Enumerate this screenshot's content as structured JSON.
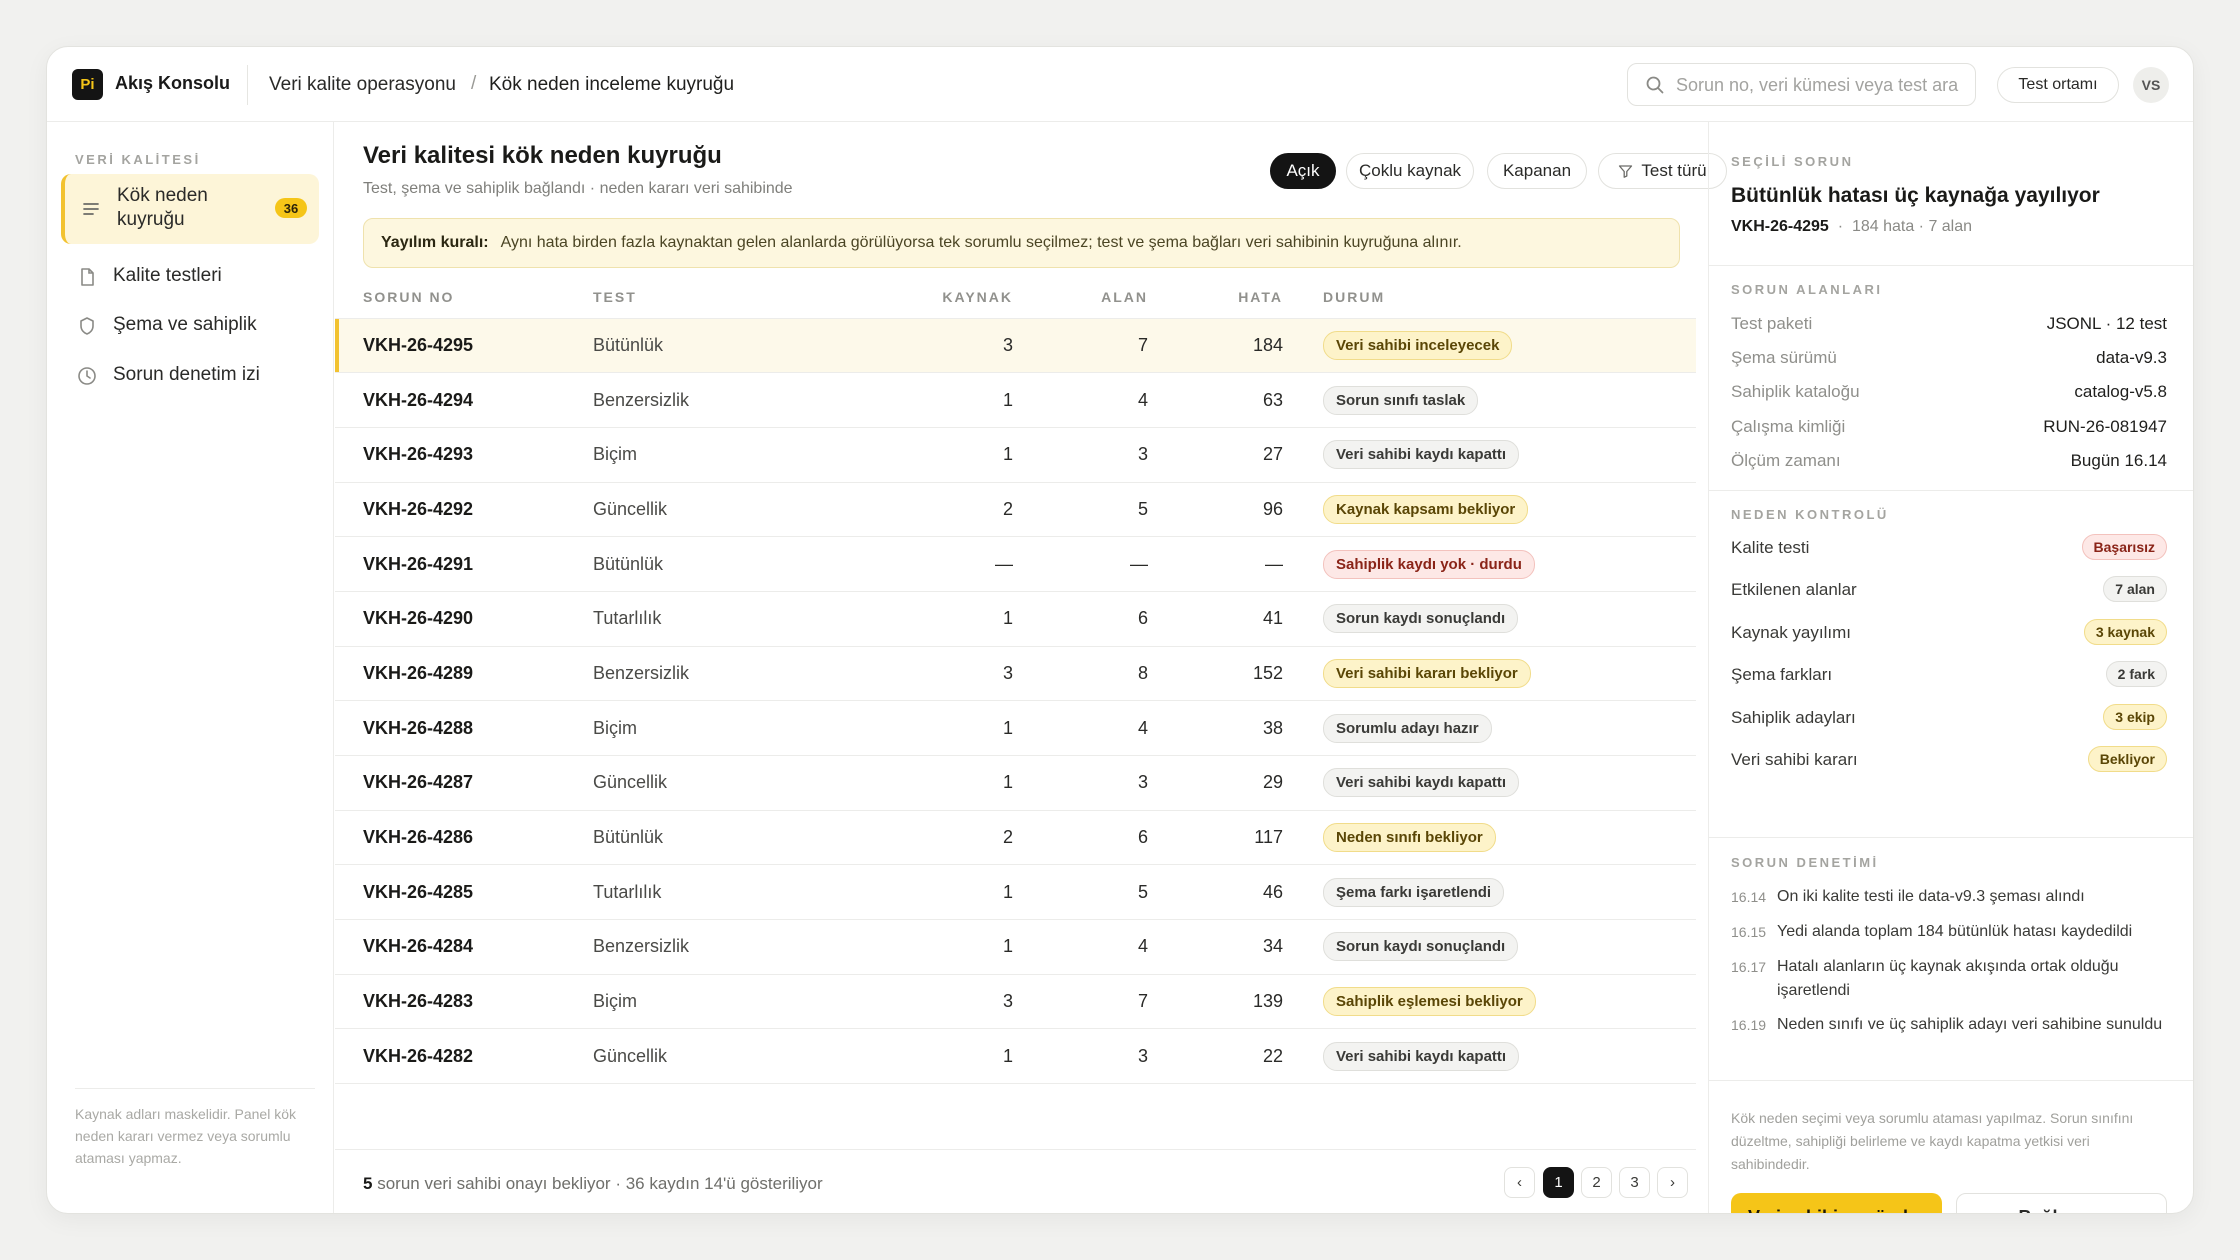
{
  "topbar": {
    "logo": "Pi",
    "app_title": "Akış Konsolu",
    "breadcrumb": [
      "Veri kalite operasyonu",
      "Kök neden inceleme kuyruğu"
    ],
    "breadcrumb_sep": "/",
    "search_placeholder": "Sorun no, veri kümesi veya test ara",
    "env_label": "Test ortamı",
    "avatar": "VS"
  },
  "sidebar": {
    "heading": "VERİ KALİTESİ",
    "items": [
      {
        "label": "Kök neden kuyruğu",
        "badge": "36",
        "icon": "list-icon"
      },
      {
        "label": "Kalite testleri",
        "icon": "document-icon"
      },
      {
        "label": "Şema ve sahiplik",
        "icon": "shield-icon"
      },
      {
        "label": "Sorun denetim izi",
        "icon": "clock-icon"
      }
    ],
    "footnote": "Kaynak adları maskelidir. Panel kök neden kararı vermez veya sorumlu ataması yapmaz."
  },
  "main": {
    "title": "Veri kalitesi kök neden kuyruğu",
    "subtitle": "Test, şema ve sahiplik bağlandı · neden kararı veri sahibinde",
    "filters": [
      "Açık",
      "Çoklu kaynak",
      "Kapanan",
      "Test türü"
    ],
    "rule_label": "Yayılım kuralı:",
    "rule_text": "Aynı hata birden fazla kaynaktan gelen alanlarda görülüyorsa tek sorumlu seçilmez; test ve şema bağları veri sahibinin kuyruğuna alınır.",
    "columns": [
      "SORUN NO",
      "TEST",
      "KAYNAK",
      "ALAN",
      "HATA",
      "DURUM"
    ],
    "rows": [
      {
        "id": "VKH-26-4295",
        "test": "Bütünlük",
        "kaynak": "3",
        "alan": "7",
        "hata": "184",
        "status": "Veri sahibi inceleyecek",
        "tone": "yellow"
      },
      {
        "id": "VKH-26-4294",
        "test": "Benzersizlik",
        "kaynak": "1",
        "alan": "4",
        "hata": "63",
        "status": "Sorun sınıfı taslak",
        "tone": "gray"
      },
      {
        "id": "VKH-26-4293",
        "test": "Biçim",
        "kaynak": "1",
        "alan": "3",
        "hata": "27",
        "status": "Veri sahibi kaydı kapattı",
        "tone": "gray"
      },
      {
        "id": "VKH-26-4292",
        "test": "Güncellik",
        "kaynak": "2",
        "alan": "5",
        "hata": "96",
        "status": "Kaynak kapsamı bekliyor",
        "tone": "yellow"
      },
      {
        "id": "VKH-26-4291",
        "test": "Bütünlük",
        "kaynak": "—",
        "alan": "—",
        "hata": "—",
        "status": "Sahiplik kaydı yok · durdu",
        "tone": "red"
      },
      {
        "id": "VKH-26-4290",
        "test": "Tutarlılık",
        "kaynak": "1",
        "alan": "6",
        "hata": "41",
        "status": "Sorun kaydı sonuçlandı",
        "tone": "gray"
      },
      {
        "id": "VKH-26-4289",
        "test": "Benzersizlik",
        "kaynak": "3",
        "alan": "8",
        "hata": "152",
        "status": "Veri sahibi kararı bekliyor",
        "tone": "yellow"
      },
      {
        "id": "VKH-26-4288",
        "test": "Biçim",
        "kaynak": "1",
        "alan": "4",
        "hata": "38",
        "status": "Sorumlu adayı hazır",
        "tone": "gray"
      },
      {
        "id": "VKH-26-4287",
        "test": "Güncellik",
        "kaynak": "1",
        "alan": "3",
        "hata": "29",
        "status": "Veri sahibi kaydı kapattı",
        "tone": "gray"
      },
      {
        "id": "VKH-26-4286",
        "test": "Bütünlük",
        "kaynak": "2",
        "alan": "6",
        "hata": "117",
        "status": "Neden sınıfı bekliyor",
        "tone": "yellow"
      },
      {
        "id": "VKH-26-4285",
        "test": "Tutarlılık",
        "kaynak": "1",
        "alan": "5",
        "hata": "46",
        "status": "Şema farkı işaretlendi",
        "tone": "gray"
      },
      {
        "id": "VKH-26-4284",
        "test": "Benzersizlik",
        "kaynak": "1",
        "alan": "4",
        "hata": "34",
        "status": "Sorun kaydı sonuçlandı",
        "tone": "gray"
      },
      {
        "id": "VKH-26-4283",
        "test": "Biçim",
        "kaynak": "3",
        "alan": "7",
        "hata": "139",
        "status": "Sahiplik eşlemesi bekliyor",
        "tone": "yellow"
      },
      {
        "id": "VKH-26-4282",
        "test": "Güncellik",
        "kaynak": "1",
        "alan": "3",
        "hata": "22",
        "status": "Veri sahibi kaydı kapattı",
        "tone": "gray"
      }
    ],
    "footer_count": "5",
    "footer_text": "sorun veri sahibi onayı bekliyor · 36 kaydın 14'ü gösteriliyor",
    "pages": [
      "‹",
      "1",
      "2",
      "3",
      "›"
    ]
  },
  "panel": {
    "selected_heading": "SEÇİLİ SORUN",
    "title": "Bütünlük hatası üç kaynağa yayılıyor",
    "id": "VKH-26-4295",
    "meta": "184 hata · 7 alan",
    "fields_heading": "SORUN ALANLARI",
    "fields": [
      {
        "k": "Test paketi",
        "v": "JSONL · 12 test"
      },
      {
        "k": "Şema sürümü",
        "v": "data-v9.3"
      },
      {
        "k": "Sahiplik kataloğu",
        "v": "catalog-v5.8"
      },
      {
        "k": "Çalışma kimliği",
        "v": "RUN-26-081947"
      },
      {
        "k": "Ölçüm zamanı",
        "v": "Bugün 16.14"
      }
    ],
    "checks_heading": "NEDEN KONTROLÜ",
    "checks": [
      {
        "k": "Kalite testi",
        "v": "Başarısız",
        "tone": "red"
      },
      {
        "k": "Etkilenen alanlar",
        "v": "7 alan",
        "tone": "gray"
      },
      {
        "k": "Kaynak yayılımı",
        "v": "3 kaynak",
        "tone": "yellow"
      },
      {
        "k": "Şema farkları",
        "v": "2 fark",
        "tone": "gray"
      },
      {
        "k": "Sahiplik adayları",
        "v": "3 ekip",
        "tone": "yellow"
      },
      {
        "k": "Veri sahibi kararı",
        "v": "Bekliyor",
        "tone": "yellow"
      }
    ],
    "audit_heading": "SORUN DENETİMİ",
    "audit": [
      {
        "t": "16.14",
        "m": "On iki kalite testi ile data-v9.3 şeması alındı"
      },
      {
        "t": "16.15",
        "m": "Yedi alanda toplam 184 bütünlük hatası kaydedildi"
      },
      {
        "t": "16.17",
        "m": "Hatalı alanların üç kaynak akışında ortak olduğu işaretlendi"
      },
      {
        "t": "16.19",
        "m": "Neden sınıfı ve üç sahiplik adayı veri sahibine sunuldu"
      }
    ],
    "note": "Kök neden seçimi veya sorumlu ataması yapılmaz. Sorun sınıfını düzeltme, sahipliği belirleme ve kaydı kapatma yetkisi veri sahibindedir.",
    "primary_btn": "Veri sahibine gönder",
    "secondary_btn": "Bağları aç"
  }
}
